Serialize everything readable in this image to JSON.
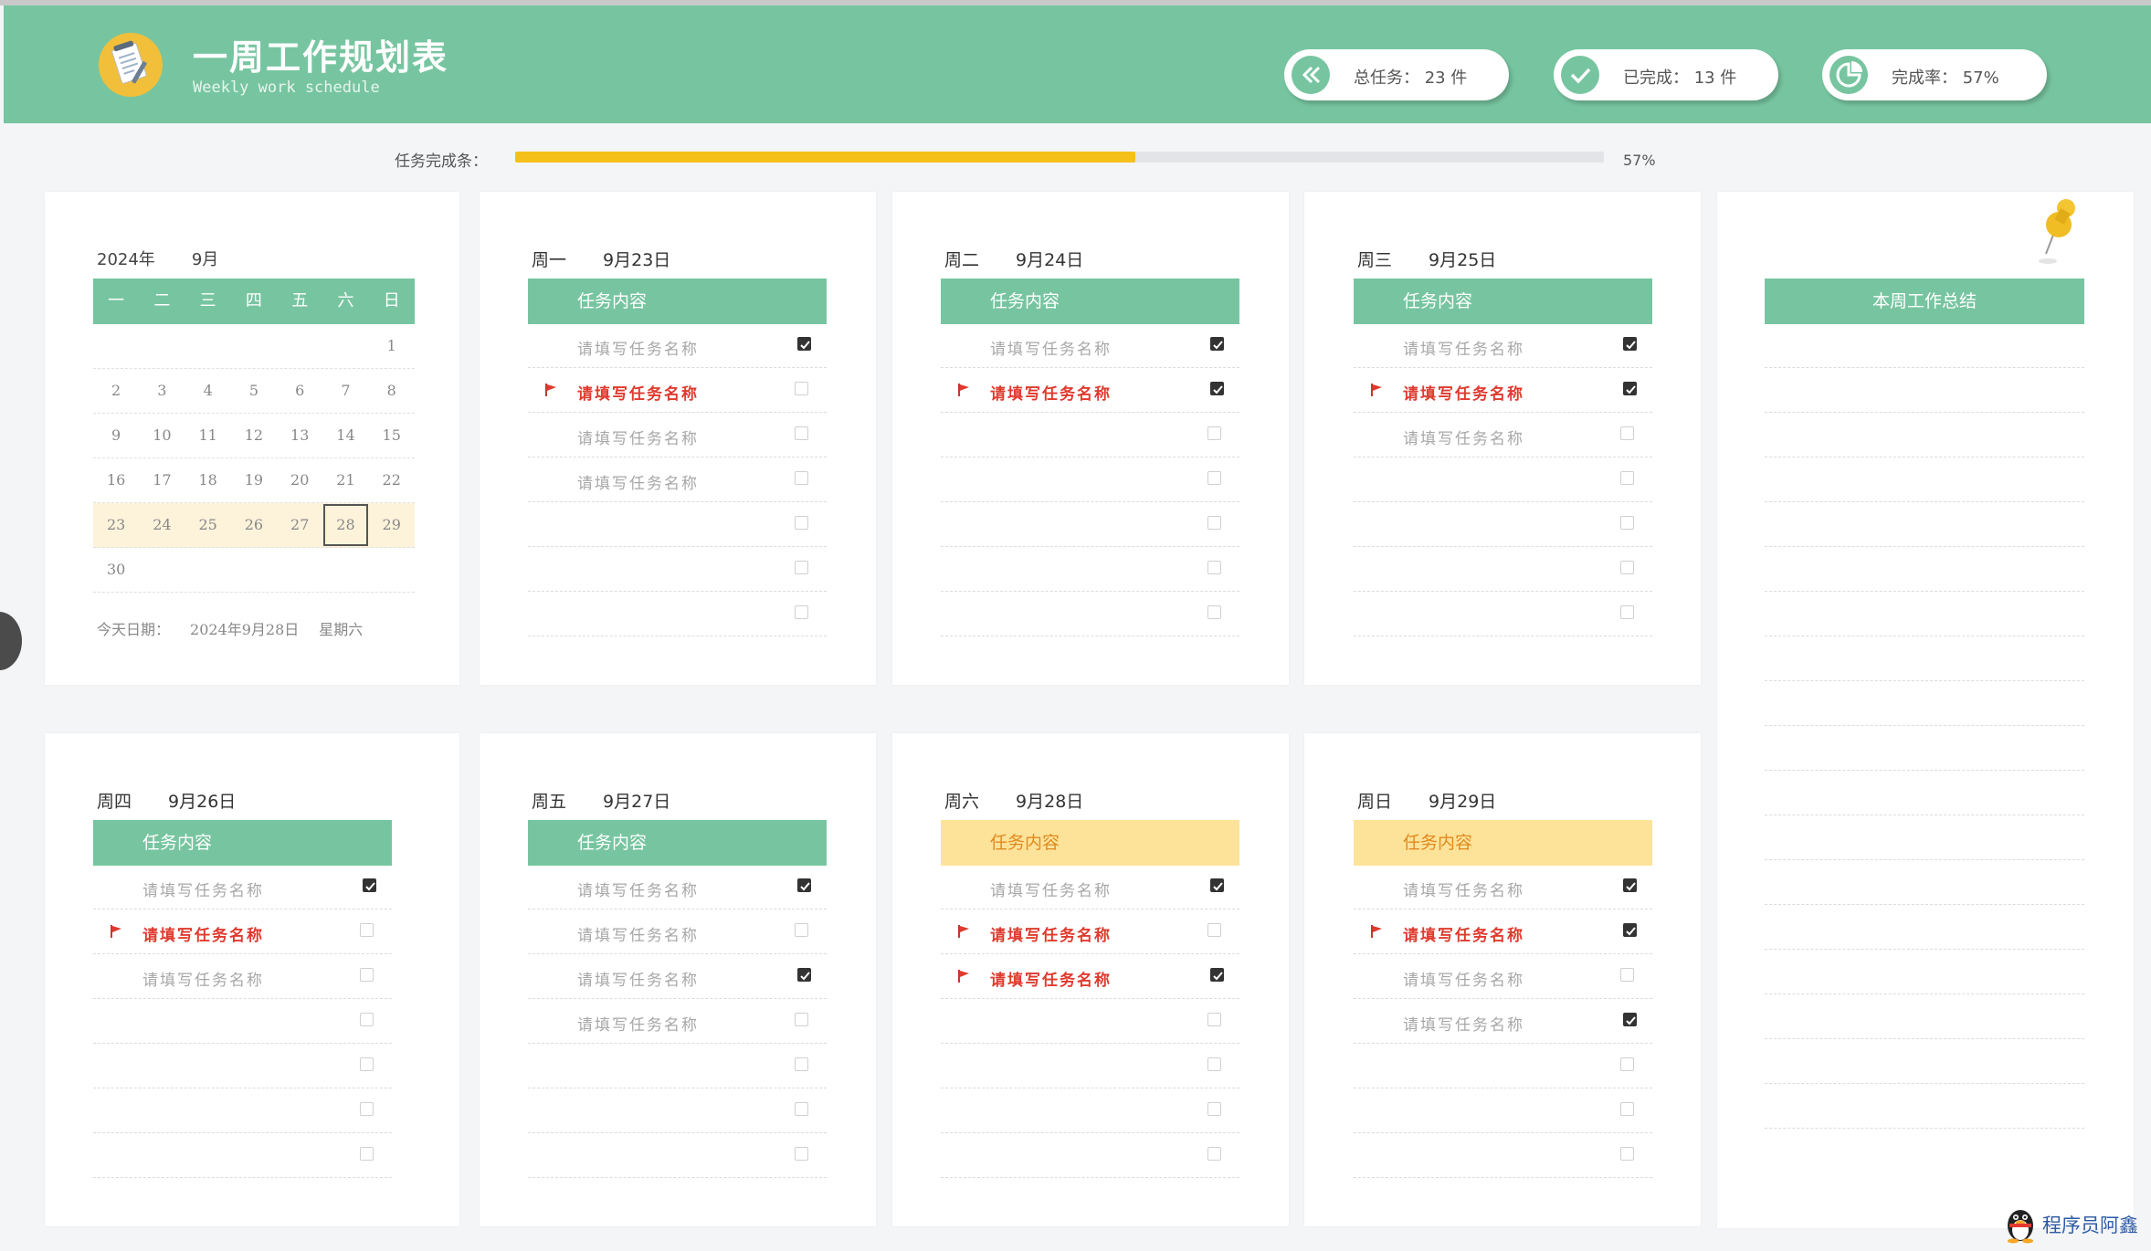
{
  "header": {
    "title": "一周工作规划表",
    "subtitle": "Weekly work schedule",
    "stats": [
      {
        "label": "总任务：",
        "value": "23",
        "unit": "件"
      },
      {
        "label": "已完成：",
        "value": "13",
        "unit": "件"
      },
      {
        "label": "完成率：",
        "value": "57%",
        "unit": ""
      }
    ]
  },
  "progress": {
    "label": "任务完成条：",
    "percent": 57,
    "text": "57%"
  },
  "calendar": {
    "year": "2024年",
    "month": "9月",
    "weekdays": [
      "一",
      "二",
      "三",
      "四",
      "五",
      "六",
      "日"
    ],
    "weeks": [
      [
        "",
        "",
        "",
        "",
        "",
        "",
        "1"
      ],
      [
        "2",
        "3",
        "4",
        "5",
        "6",
        "7",
        "8"
      ],
      [
        "9",
        "10",
        "11",
        "12",
        "13",
        "14",
        "15"
      ],
      [
        "16",
        "17",
        "18",
        "19",
        "20",
        "21",
        "22"
      ],
      [
        "23",
        "24",
        "25",
        "26",
        "27",
        "28",
        "29"
      ],
      [
        "30",
        "",
        "",
        "",
        "",
        "",
        ""
      ]
    ],
    "current_week_index": 4,
    "today_day": "28",
    "today_label": "今天日期：",
    "today_value": "2024年9月28日",
    "today_weekday": "星期六"
  },
  "task_header": "任务内容",
  "summary": {
    "title": "本周工作总结"
  },
  "days": [
    {
      "weekday": "周一",
      "date": "9月23日",
      "weekend": false,
      "tasks": [
        {
          "name": "请填写任务名称",
          "urgent": false,
          "done": true
        },
        {
          "name": "请填写任务名称",
          "urgent": true,
          "done": false
        },
        {
          "name": "请填写任务名称",
          "urgent": false,
          "done": false
        },
        {
          "name": "请填写任务名称",
          "urgent": false,
          "done": false
        },
        {
          "name": "",
          "urgent": false,
          "done": false
        },
        {
          "name": "",
          "urgent": false,
          "done": false
        },
        {
          "name": "",
          "urgent": false,
          "done": false
        }
      ]
    },
    {
      "weekday": "周二",
      "date": "9月24日",
      "weekend": false,
      "tasks": [
        {
          "name": "请填写任务名称",
          "urgent": false,
          "done": true
        },
        {
          "name": "请填写任务名称",
          "urgent": true,
          "done": true
        },
        {
          "name": "",
          "urgent": false,
          "done": false
        },
        {
          "name": "",
          "urgent": false,
          "done": false
        },
        {
          "name": "",
          "urgent": false,
          "done": false
        },
        {
          "name": "",
          "urgent": false,
          "done": false
        },
        {
          "name": "",
          "urgent": false,
          "done": false
        }
      ]
    },
    {
      "weekday": "周三",
      "date": "9月25日",
      "weekend": false,
      "tasks": [
        {
          "name": "请填写任务名称",
          "urgent": false,
          "done": true
        },
        {
          "name": "请填写任务名称",
          "urgent": true,
          "done": true
        },
        {
          "name": "请填写任务名称",
          "urgent": false,
          "done": false
        },
        {
          "name": "",
          "urgent": false,
          "done": false
        },
        {
          "name": "",
          "urgent": false,
          "done": false
        },
        {
          "name": "",
          "urgent": false,
          "done": false
        },
        {
          "name": "",
          "urgent": false,
          "done": false
        }
      ]
    },
    {
      "weekday": "周四",
      "date": "9月26日",
      "weekend": false,
      "tasks": [
        {
          "name": "请填写任务名称",
          "urgent": false,
          "done": true
        },
        {
          "name": "请填写任务名称",
          "urgent": true,
          "done": false
        },
        {
          "name": "请填写任务名称",
          "urgent": false,
          "done": false
        },
        {
          "name": "",
          "urgent": false,
          "done": false
        },
        {
          "name": "",
          "urgent": false,
          "done": false
        },
        {
          "name": "",
          "urgent": false,
          "done": false
        },
        {
          "name": "",
          "urgent": false,
          "done": false
        }
      ]
    },
    {
      "weekday": "周五",
      "date": "9月27日",
      "weekend": false,
      "tasks": [
        {
          "name": "请填写任务名称",
          "urgent": false,
          "done": true
        },
        {
          "name": "请填写任务名称",
          "urgent": false,
          "done": false
        },
        {
          "name": "请填写任务名称",
          "urgent": false,
          "done": true
        },
        {
          "name": "请填写任务名称",
          "urgent": false,
          "done": false
        },
        {
          "name": "",
          "urgent": false,
          "done": false
        },
        {
          "name": "",
          "urgent": false,
          "done": false
        },
        {
          "name": "",
          "urgent": false,
          "done": false
        }
      ]
    },
    {
      "weekday": "周六",
      "date": "9月28日",
      "weekend": true,
      "tasks": [
        {
          "name": "请填写任务名称",
          "urgent": false,
          "done": true
        },
        {
          "name": "请填写任务名称",
          "urgent": true,
          "done": false
        },
        {
          "name": "请填写任务名称",
          "urgent": true,
          "done": true
        },
        {
          "name": "",
          "urgent": false,
          "done": false
        },
        {
          "name": "",
          "urgent": false,
          "done": false
        },
        {
          "name": "",
          "urgent": false,
          "done": false
        },
        {
          "name": "",
          "urgent": false,
          "done": false
        }
      ]
    },
    {
      "weekday": "周日",
      "date": "9月29日",
      "weekend": true,
      "tasks": [
        {
          "name": "请填写任务名称",
          "urgent": false,
          "done": true
        },
        {
          "name": "请填写任务名称",
          "urgent": true,
          "done": true
        },
        {
          "name": "请填写任务名称",
          "urgent": false,
          "done": false
        },
        {
          "name": "请填写任务名称",
          "urgent": false,
          "done": true
        },
        {
          "name": "",
          "urgent": false,
          "done": false
        },
        {
          "name": "",
          "urgent": false,
          "done": false
        },
        {
          "name": "",
          "urgent": false,
          "done": false
        }
      ]
    }
  ],
  "watermark": "程序员阿鑫",
  "colors": {
    "accent": "#77c5a0",
    "progress": "#f5c01a",
    "weekend": "#fde39a",
    "urgent": "#e03a2e"
  }
}
